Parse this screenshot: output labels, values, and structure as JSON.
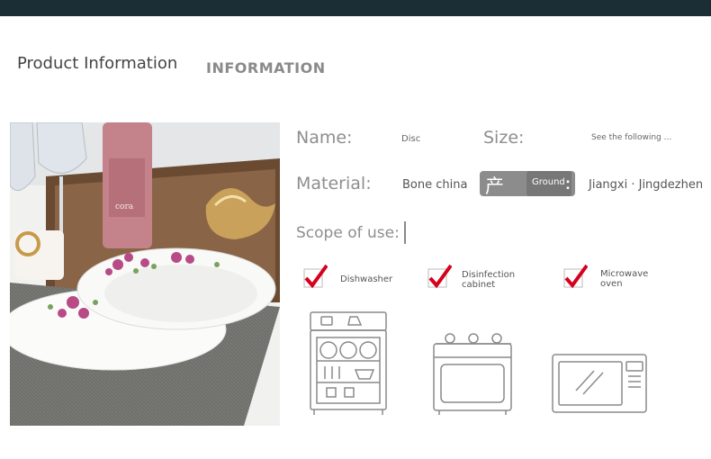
{
  "header": {
    "title_left": "Product Information",
    "title_right": "INFORMATION"
  },
  "photo": {
    "bottle_label": "cora"
  },
  "details": {
    "name_label": "Name:",
    "name_value": "Disc",
    "size_label": "Size:",
    "size_value": "See the following ...",
    "material_label": "Material:",
    "material_value": "Bone china",
    "origin_char": "产",
    "origin_badge": "Ground",
    "origin_colon": ":",
    "origin_value": "Jiangxi · Jingdezhen",
    "scope_label": "Scope of use:"
  },
  "uses": [
    {
      "label_line1": "Dishwasher",
      "label_line2": "",
      "icon": "dishwasher-icon",
      "checked": true
    },
    {
      "label_line1": "Disinfection",
      "label_line2": "cabinet",
      "icon": "disinfection-cabinet-icon",
      "checked": true
    },
    {
      "label_line1": "Microwave",
      "label_line2": "oven",
      "icon": "microwave-oven-icon",
      "checked": true
    }
  ],
  "colors": {
    "top_bar": "#1c2e35",
    "check_red": "#d6001c",
    "badge_gray": "#8c8c8c"
  }
}
